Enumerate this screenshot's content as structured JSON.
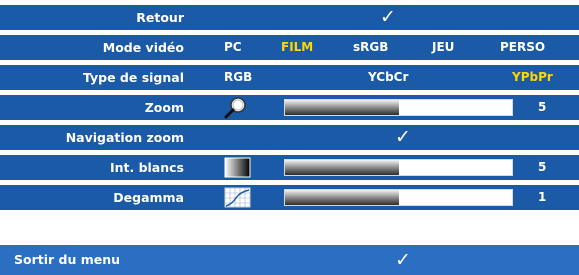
{
  "menu": {
    "retour": {
      "label": "Retour",
      "value_icon": "checkmark-icon"
    },
    "mode_video": {
      "label": "Mode vidéo",
      "options": [
        "PC",
        "FILM",
        "sRGB",
        "JEU",
        "PERSO"
      ],
      "selected": "FILM"
    },
    "type_signal": {
      "label": "Type de signal",
      "options": [
        "RGB",
        "YCbCr",
        "YPbPr"
      ],
      "selected": "YPbPr"
    },
    "zoom": {
      "label": "Zoom",
      "icon": "magnifier-icon",
      "value": "5",
      "level": 0.5
    },
    "navigation_zoom": {
      "label": "Navigation zoom",
      "value_icon": "checkmark-icon"
    },
    "int_blancs": {
      "label": "Int. blancs",
      "icon": "white-intensity-icon",
      "value": "5",
      "level": 0.5
    },
    "degamma": {
      "label": "Degamma",
      "icon": "gamma-curve-icon",
      "value": "1",
      "level": 0.5
    },
    "sortir": {
      "label": "Sortir du menu",
      "value_icon": "checkmark-icon"
    }
  },
  "colors": {
    "row_bg": "#1a5aa6",
    "exit_bg": "#2a6fc2",
    "text": "#ffffff",
    "selected": "#ffd800"
  }
}
